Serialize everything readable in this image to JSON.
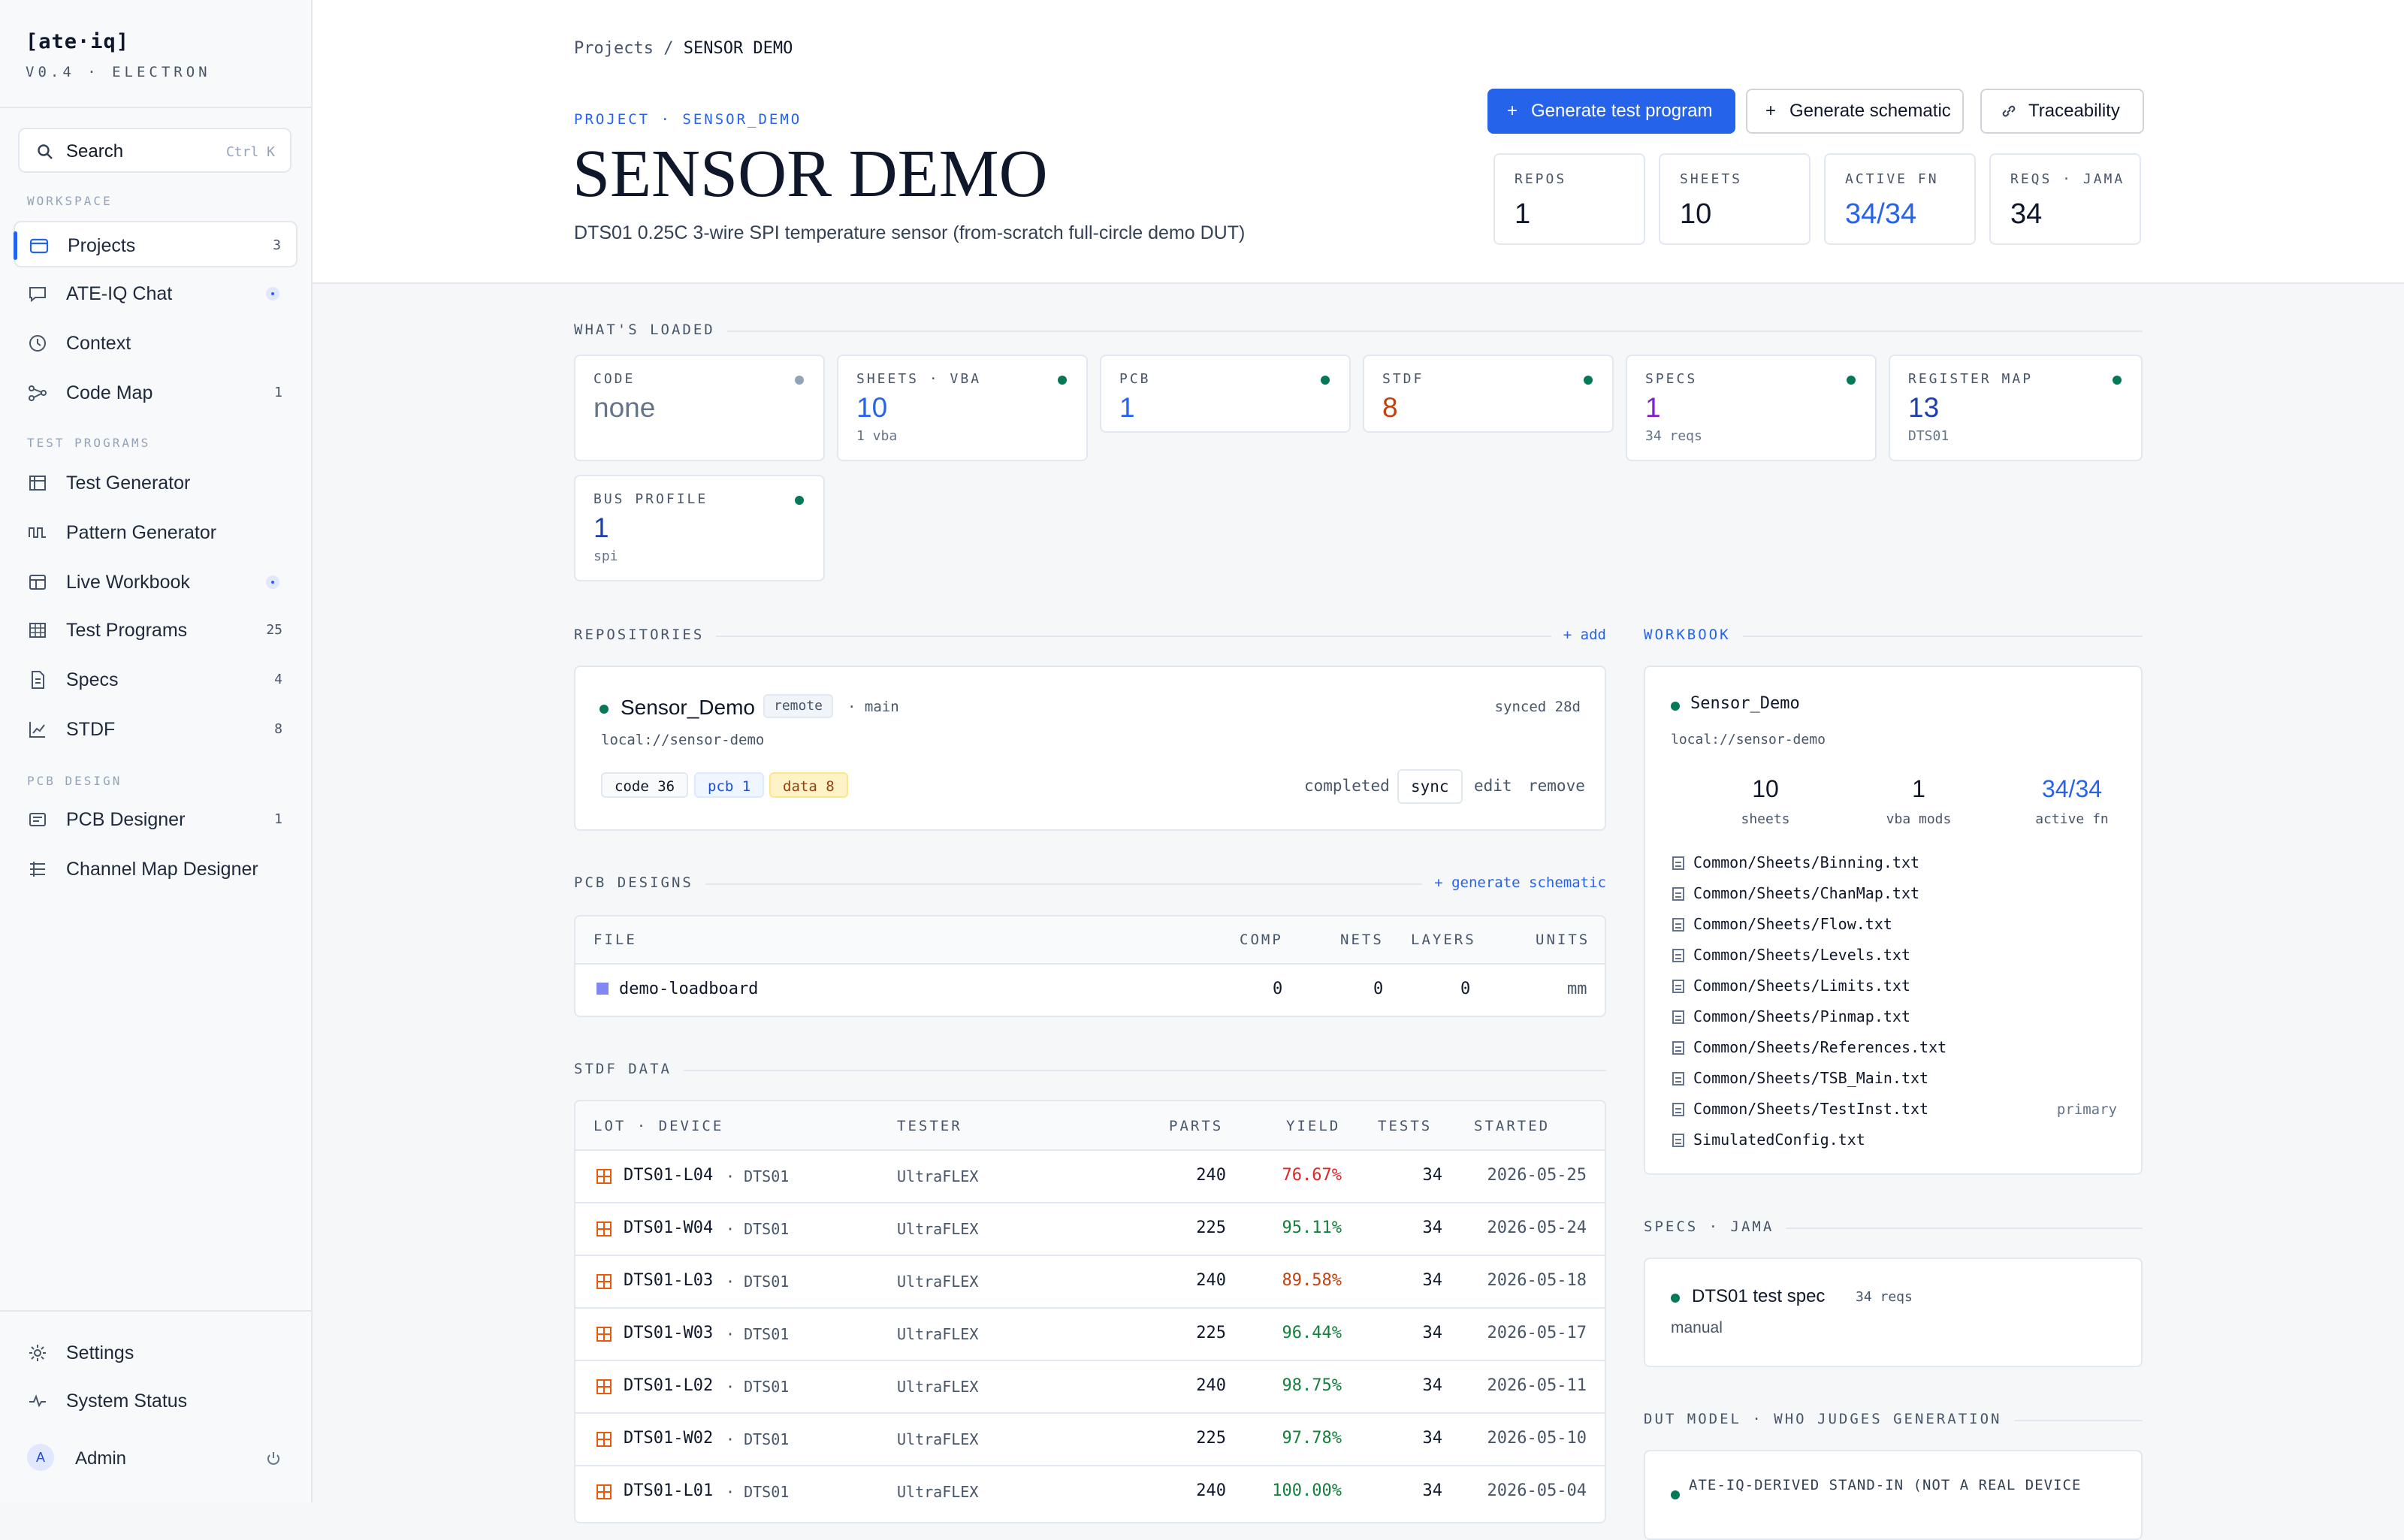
{
  "app": {
    "name": "[ate·iq]",
    "version": "V0.4 · ELECTRON"
  },
  "search": {
    "label": "Search",
    "shortcut": "Ctrl K"
  },
  "sidebar": {
    "workspace_label": "WORKSPACE",
    "test_programs_label": "TEST PROGRAMS",
    "pcb_design_label": "PCB DESIGN",
    "items": [
      {
        "label": "Projects",
        "count": "3",
        "icon": "folder-icon"
      },
      {
        "label": "ATE-IQ Chat",
        "count": "",
        "icon": "chat-icon",
        "dot": true
      },
      {
        "label": "Context",
        "count": "",
        "icon": "clock-icon"
      },
      {
        "label": "Code Map",
        "count": "1",
        "icon": "graph-icon"
      },
      {
        "label": "Test Generator",
        "count": "",
        "icon": "generator-icon"
      },
      {
        "label": "Pattern Generator",
        "count": "",
        "icon": "waveform-icon"
      },
      {
        "label": "Live Workbook",
        "count": "",
        "icon": "workbook-icon",
        "dot": true
      },
      {
        "label": "Test Programs",
        "count": "25",
        "icon": "grid-icon"
      },
      {
        "label": "Specs",
        "count": "4",
        "icon": "document-icon"
      },
      {
        "label": "STDF",
        "count": "8",
        "icon": "chart-icon"
      },
      {
        "label": "PCB Designer",
        "count": "1",
        "icon": "board-icon"
      },
      {
        "label": "Channel Map Designer",
        "count": "",
        "icon": "channels-icon"
      }
    ],
    "settings": "Settings",
    "system_status": "System Status",
    "user": {
      "initial": "A",
      "name": "Admin"
    }
  },
  "header": {
    "breadcrumb_root": "Projects",
    "breadcrumb_sep": "/",
    "breadcrumb_current": "SENSOR DEMO",
    "project_label": "PROJECT · SENSOR_DEMO",
    "title": "SENSOR DEMO",
    "subtitle": "DTS01 0.25C 3-wire SPI temperature sensor (from-scratch full-circle demo DUT)",
    "buttons": {
      "generate_test_program": "Generate test program",
      "generate_schematic": "Generate schematic",
      "traceability": "Traceability"
    },
    "stats": [
      {
        "label": "REPOS",
        "value": "1"
      },
      {
        "label": "SHEETS",
        "value": "10"
      },
      {
        "label": "ACTIVE FN",
        "value": "34/34"
      },
      {
        "label": "REQS · JAMA",
        "value": "34"
      }
    ]
  },
  "loaded": {
    "title": "WHAT'S LOADED",
    "cards": [
      {
        "label": "CODE",
        "value": "none",
        "sub": "",
        "value_color": "#64748b",
        "dot": "#94a3b8"
      },
      {
        "label": "SHEETS · VBA",
        "value": "10",
        "sub": "1 vba",
        "value_color": "#2563eb",
        "dot": "#047857"
      },
      {
        "label": "PCB",
        "value": "1",
        "sub": "",
        "value_color": "#2563eb",
        "dot": "#047857"
      },
      {
        "label": "STDF",
        "value": "8",
        "sub": "",
        "value_color": "#c2410c",
        "dot": "#047857"
      },
      {
        "label": "SPECS",
        "value": "1",
        "sub": "34 reqs",
        "value_color": "#7e22ce",
        "dot": "#047857"
      },
      {
        "label": "REGISTER MAP",
        "value": "13",
        "sub": "DTS01",
        "value_color": "#1e40af",
        "dot": "#047857"
      },
      {
        "label": "BUS PROFILE",
        "value": "1",
        "sub": "spi",
        "value_color": "#1e40af",
        "dot": "#047857"
      }
    ]
  },
  "repositories": {
    "title": "REPOSITORIES",
    "add": "+ add",
    "repo": {
      "name": "Sensor_Demo",
      "remote": "remote",
      "branch": "· main",
      "synced": "synced 28d",
      "path": "local://sensor-demo",
      "tags": [
        "code 36",
        "pcb 1",
        "data 8"
      ],
      "status": "completed",
      "sync": "sync",
      "edit": "edit",
      "remove": "remove"
    }
  },
  "pcb": {
    "title": "PCB DESIGNS",
    "link": "+ generate schematic",
    "headers": [
      "FILE",
      "COMP",
      "NETS",
      "LAYERS",
      "UNITS"
    ],
    "rows": [
      {
        "file": "demo-loadboard",
        "comp": "0",
        "nets": "0",
        "layers": "0",
        "units": "mm"
      }
    ]
  },
  "stdf": {
    "title": "STDF DATA",
    "headers": [
      "LOT · DEVICE",
      "TESTER",
      "PARTS",
      "YIELD",
      "TESTS",
      "STARTED"
    ],
    "rows": [
      {
        "lot": "DTS01-L04",
        "device": "· DTS01",
        "tester": "UltraFLEX",
        "parts": "240",
        "yield": "76.67%",
        "yield_color": "#dc2626",
        "tests": "34",
        "started": "2026-05-25"
      },
      {
        "lot": "DTS01-W04",
        "device": "· DTS01",
        "tester": "UltraFLEX",
        "parts": "225",
        "yield": "95.11%",
        "yield_color": "#15803d",
        "tests": "34",
        "started": "2026-05-24"
      },
      {
        "lot": "DTS01-L03",
        "device": "· DTS01",
        "tester": "UltraFLEX",
        "parts": "240",
        "yield": "89.58%",
        "yield_color": "#c2410c",
        "tests": "34",
        "started": "2026-05-18"
      },
      {
        "lot": "DTS01-W03",
        "device": "· DTS01",
        "tester": "UltraFLEX",
        "parts": "225",
        "yield": "96.44%",
        "yield_color": "#15803d",
        "tests": "34",
        "started": "2026-05-17"
      },
      {
        "lot": "DTS01-L02",
        "device": "· DTS01",
        "tester": "UltraFLEX",
        "parts": "240",
        "yield": "98.75%",
        "yield_color": "#15803d",
        "tests": "34",
        "started": "2026-05-11"
      },
      {
        "lot": "DTS01-W02",
        "device": "· DTS01",
        "tester": "UltraFLEX",
        "parts": "225",
        "yield": "97.78%",
        "yield_color": "#15803d",
        "tests": "34",
        "started": "2026-05-10"
      },
      {
        "lot": "DTS01-L01",
        "device": "· DTS01",
        "tester": "UltraFLEX",
        "parts": "240",
        "yield": "100.00%",
        "yield_color": "#15803d",
        "tests": "34",
        "started": "2026-05-04"
      }
    ]
  },
  "workbook": {
    "title": "WORKBOOK",
    "name": "Sensor_Demo",
    "path": "local://sensor-demo",
    "stats": [
      {
        "value": "10",
        "label": "sheets"
      },
      {
        "value": "1",
        "label": "vba mods"
      },
      {
        "value": "34/34",
        "label": "active fn"
      }
    ],
    "files": [
      "Common/Sheets/Binning.txt",
      "Common/Sheets/ChanMap.txt",
      "Common/Sheets/Flow.txt",
      "Common/Sheets/Levels.txt",
      "Common/Sheets/Limits.txt",
      "Common/Sheets/Pinmap.txt",
      "Common/Sheets/References.txt",
      "Common/Sheets/TSB_Main.txt",
      "Common/Sheets/TestInst.txt",
      "SimulatedConfig.txt"
    ],
    "primary_label": "primary"
  },
  "specs": {
    "title": "SPECS · JAMA",
    "name": "DTS01 test spec",
    "reqs": "34 reqs",
    "mode": "manual"
  },
  "dut": {
    "title": "DUT MODEL · WHO JUDGES GENERATION",
    "text": "ATE-IQ-DERIVED STAND-IN (NOT A REAL DEVICE"
  },
  "colors": {
    "accent": "#2563eb",
    "ok": "#047857",
    "warn": "#c2410c",
    "bad": "#dc2626"
  }
}
